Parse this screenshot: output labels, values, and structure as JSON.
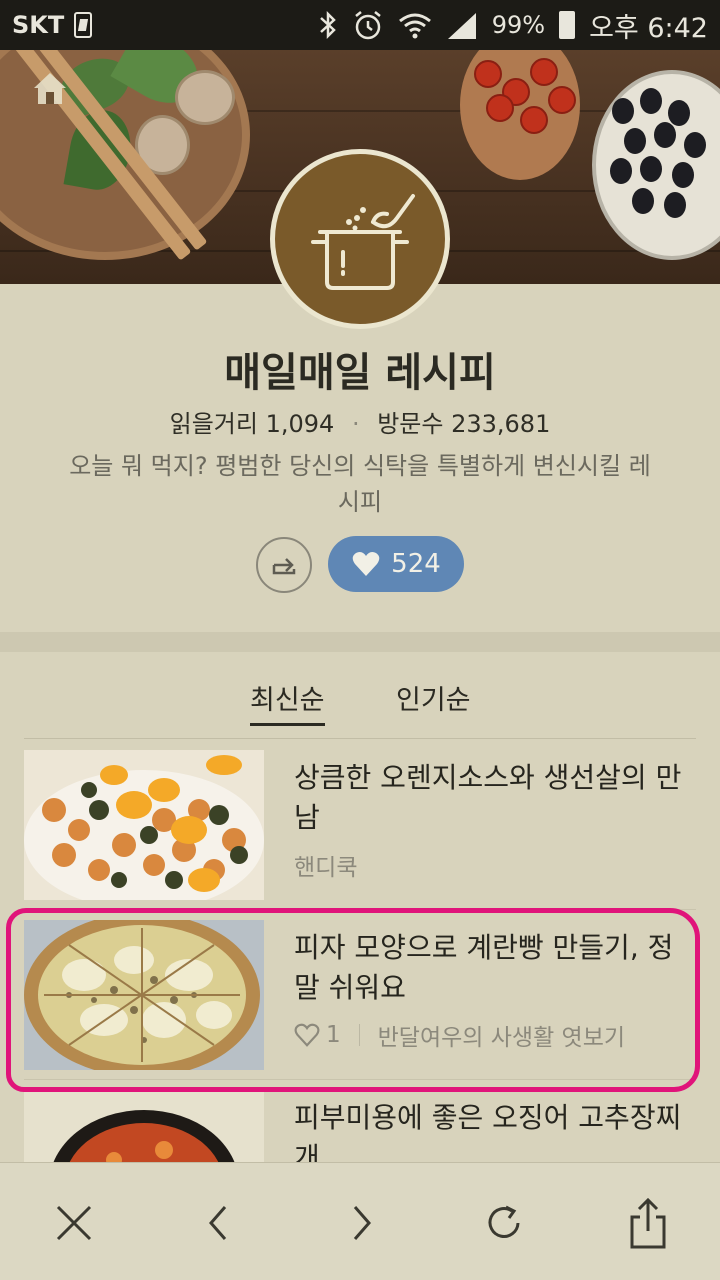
{
  "status_bar": {
    "carrier": "SKT",
    "battery": "99%",
    "time": "오후 6:42",
    "icons": [
      "sim-icon",
      "bluetooth-icon",
      "alarm-icon",
      "wifi-icon",
      "signal-icon",
      "battery-icon"
    ]
  },
  "header": {
    "icons": [
      "home-icon",
      "pot-logo-icon"
    ]
  },
  "profile": {
    "title": "매일매일 레시피",
    "stats_reads": "읽을거리 1,094",
    "stats_sep": "·",
    "stats_visits": "방문수 233,681",
    "description": "오늘 뭐 먹지? 평범한 당신의 식탁을 특별하게 변신시킬 레시피",
    "like_count": "524",
    "like_color": "#5f87b5"
  },
  "tabs": [
    {
      "label": "최신순",
      "active": true
    },
    {
      "label": "인기순",
      "active": false
    }
  ],
  "posts": [
    {
      "title": "상큼한 오렌지소스와 생선살의 만남",
      "author": "핸디쿡"
    },
    {
      "title": "피자 모양으로 계란빵 만들기, 정말 쉬워요",
      "likes": "1",
      "author": "반달여우의 사생활 엿보기"
    },
    {
      "title": "피부미용에 좋은 오징어 고추장찌개"
    }
  ],
  "highlight_color": "#e0147a",
  "bottom_nav": {
    "icons": [
      "close-icon",
      "back-icon",
      "forward-icon",
      "refresh-icon",
      "share-icon"
    ]
  }
}
